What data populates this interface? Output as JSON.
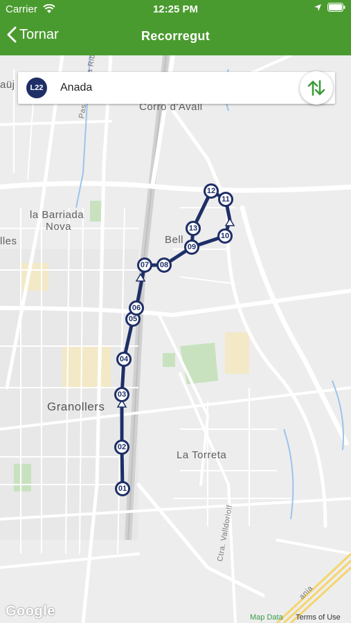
{
  "status_bar": {
    "carrier": "Carrier",
    "time": "12:25 PM"
  },
  "nav": {
    "back_label": "Tornar",
    "title": "Recorregut"
  },
  "route": {
    "line": "L22",
    "direction": "Anada",
    "line_color": "#1e2f67"
  },
  "map_labels": {
    "corro": "Corro d'Avall",
    "barriada_1": "la Barriada",
    "barriada_2": "Nova",
    "granollers": "Granollers",
    "torreta": "La Torreta",
    "belles": "Bell",
    "lles": "lles",
    "rauj": "aüj",
    "passeig": "Passeig de la Ribe",
    "ctra": "Ctra. Valldoriolf",
    "ania": "ania"
  },
  "stops": [
    "01",
    "02",
    "03",
    "04",
    "05",
    "06",
    "07",
    "08",
    "09",
    "10",
    "11",
    "12",
    "13"
  ],
  "attribution": {
    "google": "Google",
    "map_data": "Map Data",
    "terms": "Terms of Use"
  },
  "colors": {
    "nav_green": "#4a9b2f",
    "route": "#1e2f67",
    "swap_arrows": "#3d9a3a"
  }
}
